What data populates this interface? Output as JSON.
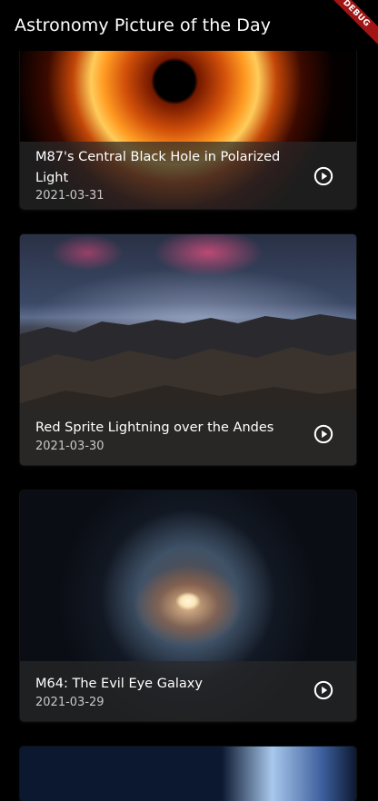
{
  "app_bar": {
    "title": "Astronomy Picture of the Day"
  },
  "debug_banner": {
    "label": "DEBUG",
    "color": "#a31515"
  },
  "items": [
    {
      "title": "M87's Central Black Hole in Polarized Light",
      "date": "2021-03-31",
      "icon": "play-circle-icon"
    },
    {
      "title": "Red Sprite Lightning over the Andes",
      "date": "2021-03-30",
      "icon": "play-circle-icon"
    },
    {
      "title": "M64: The Evil Eye Galaxy",
      "date": "2021-03-29",
      "icon": "play-circle-icon"
    }
  ]
}
